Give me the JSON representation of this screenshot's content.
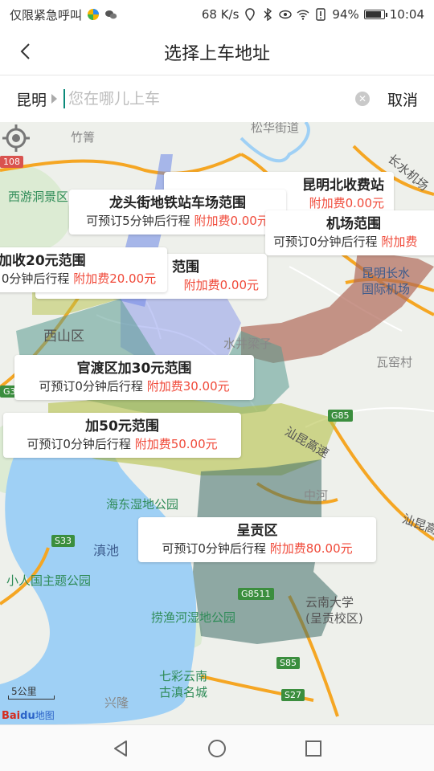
{
  "status_bar": {
    "carrier": "仅限紧急呼叫",
    "network_speed": "68 K/s",
    "battery": "94%",
    "battery_level": 0.94,
    "time": "10:04"
  },
  "header": {
    "title": "选择上车地址"
  },
  "search": {
    "city": "昆明",
    "placeholder": "您在哪儿上车",
    "value": "",
    "cancel_label": "取消"
  },
  "map": {
    "labels": {
      "zhuguo": "竹箐",
      "songhua": "松华街道",
      "changshui": "长水机场",
      "xishan_view": "西游洞景区",
      "xishan": "西山区",
      "shuijing": "水井梁子",
      "kunming_airport": "昆明长水\n国际机场",
      "wayao": "瓦窑村",
      "shankun": "汕昆高速",
      "zhonghe": "中河",
      "haidong": "海东湿地公园",
      "dianchi": "滇池",
      "xiaorenguo": "小人国主题公园",
      "laoyuhe": "捞渔河湿地公园",
      "yunnan_univ": "云南大学\n(呈贡校区)",
      "qicai": "七彩云南\n古滇名城",
      "xinglong": "兴隆",
      "shankun2": "汕昆高"
    },
    "highways": {
      "g108": "108",
      "g85": "G85",
      "s33": "S33",
      "g8511": "G8511",
      "s85": "S85",
      "s27": "S27",
      "g3": "G3"
    },
    "scale_label": "5公里",
    "logo": {
      "bai": "Bai",
      "du": "du",
      "text": "地图"
    }
  },
  "zones": [
    {
      "name": "昆明北收费站",
      "line": "",
      "fee": "附加费0.00元"
    },
    {
      "name": "龙头街地铁站车场范围",
      "line": "可预订5分钟后行程",
      "fee": "附加费0.00元"
    },
    {
      "name": "机场范围",
      "line": "可预订0分钟后行程",
      "fee": "附加费"
    },
    {
      "name": "加收20元范围",
      "line": "0分钟后行程",
      "fee": "附加费20.00元"
    },
    {
      "name": "范围",
      "line": "",
      "fee": "附加费0.00元"
    },
    {
      "name": "官渡区加30元范围",
      "line": "可预订0分钟后行程",
      "fee": "附加费30.00元"
    },
    {
      "name": "加50元范围",
      "line": "可预订0分钟后行程",
      "fee": "附加费50.00元"
    },
    {
      "name": "呈贡区",
      "line": "可预订0分钟后行程",
      "fee": "附加费80.00元"
    }
  ],
  "colors": {
    "fee_red": "#f04a3a",
    "zone_blue": "#6b86e8",
    "zone_brown": "#b06a5a",
    "zone_teal": "#5a9a90",
    "zone_olive": "#b5c24a",
    "zone_grey": "#6e8a7a",
    "lake": "#9fd0f5",
    "road_orange": "#f5a623"
  }
}
